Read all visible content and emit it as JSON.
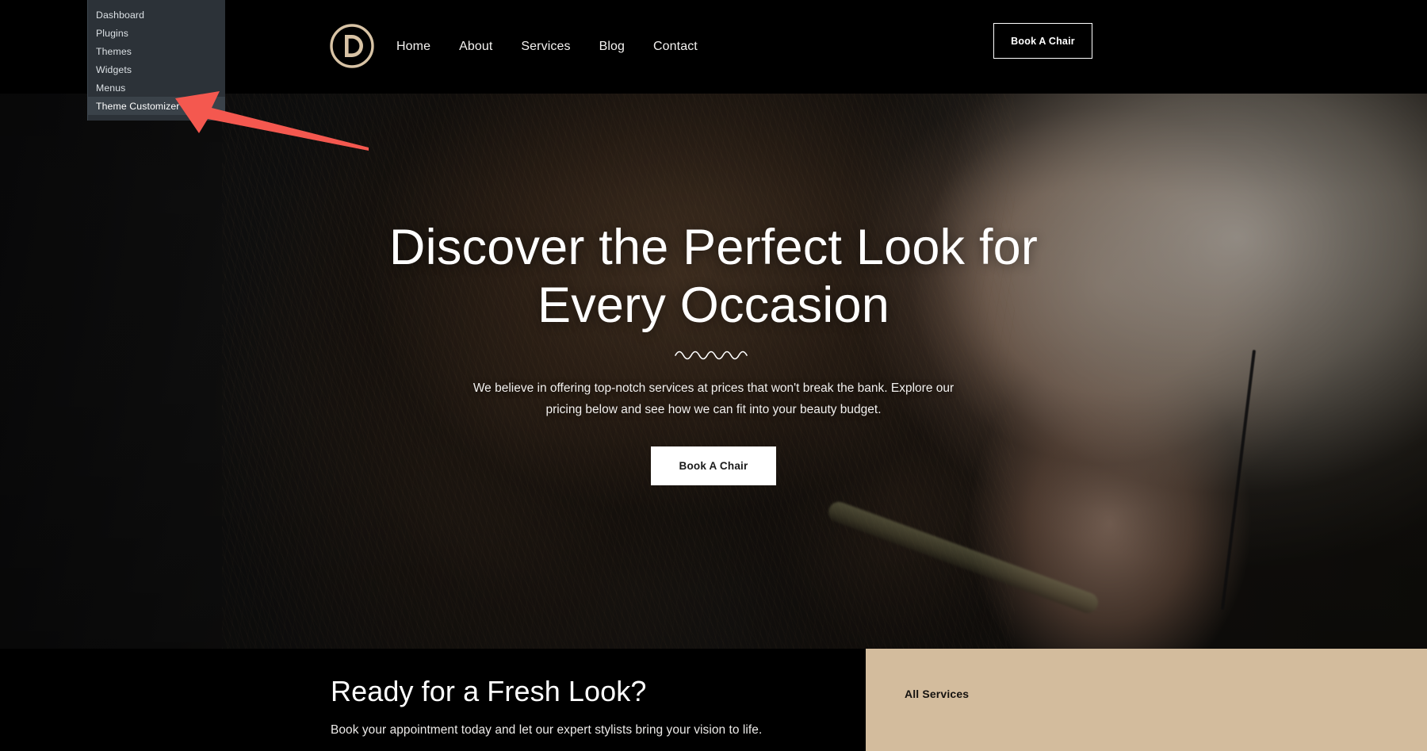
{
  "admin_menu": {
    "name": "wp-admin-dropdown",
    "background_color": "#2c3238",
    "items": [
      {
        "label": "Dashboard",
        "active": false
      },
      {
        "label": "Plugins",
        "active": false
      },
      {
        "label": "Themes",
        "active": false
      },
      {
        "label": "Widgets",
        "active": false
      },
      {
        "label": "Menus",
        "active": false
      },
      {
        "label": "Theme Customizer",
        "active": true
      }
    ]
  },
  "annotation": {
    "type": "arrow",
    "color": "#f4584f",
    "points_to": "Theme Customizer",
    "direction": "left"
  },
  "navbar": {
    "logo_letter": "D",
    "logo_color": "#d8c3a5",
    "background_color": "#000000",
    "links": [
      {
        "label": "Home"
      },
      {
        "label": "About"
      },
      {
        "label": "Services"
      },
      {
        "label": "Blog"
      },
      {
        "label": "Contact"
      }
    ],
    "cta_label": "Book A Chair"
  },
  "hero": {
    "title_line1": "Discover the Perfect Look for",
    "title_line2": "Every Occasion",
    "divider": "wavy-line",
    "paragraph": "We believe in offering top-notch services at prices that won't break the bank. Explore our pricing below and see how we can fit into your beauty budget.",
    "cta_label": "Book A Chair",
    "image_alt": "stylist curling long brown hair with a curling iron"
  },
  "bottom": {
    "heading": "Ready for a Fresh Look?",
    "subheading": "Book your appointment today and let our expert stylists bring your vision to life.",
    "panel": {
      "label": "All Services",
      "background_color": "#d3bc9d"
    }
  }
}
